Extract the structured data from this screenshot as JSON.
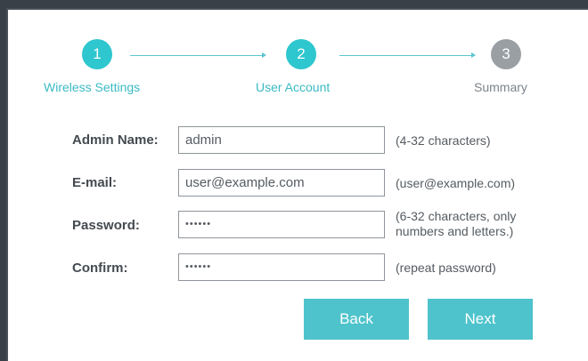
{
  "colors": {
    "accent": "#4ec3cc",
    "step_active": "#2ec6cf",
    "step_inactive": "#9a9fa4",
    "label_active": "#3bbac4",
    "label_inactive": "#7d8389"
  },
  "steps": [
    {
      "number": "1",
      "label": "Wireless Settings",
      "state": "complete"
    },
    {
      "number": "2",
      "label": "User Account",
      "state": "active"
    },
    {
      "number": "3",
      "label": "Summary",
      "state": "pending"
    }
  ],
  "form": {
    "admin_name": {
      "label": "Admin Name:",
      "value": "admin",
      "hint": "(4-32 characters)"
    },
    "email": {
      "label": "E-mail:",
      "value": "user@example.com",
      "hint": "(user@example.com)"
    },
    "password": {
      "label": "Password:",
      "value": "••••••",
      "hint_line1": "(6-32 characters, only",
      "hint_line2": "numbers and letters.)"
    },
    "confirm": {
      "label": "Confirm:",
      "value": "••••••",
      "hint": "(repeat password)"
    }
  },
  "buttons": {
    "back": "Back",
    "next": "Next"
  }
}
